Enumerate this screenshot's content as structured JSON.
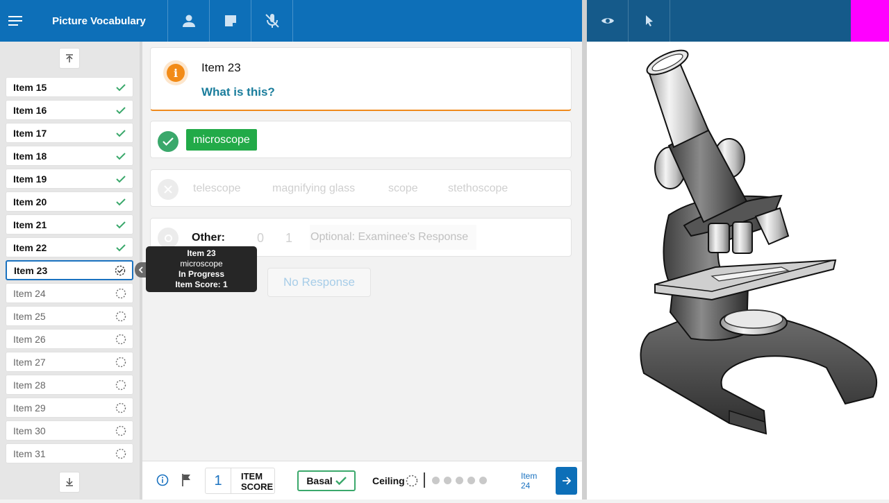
{
  "header": {
    "title": "Picture Vocabulary"
  },
  "sidebar": {
    "items": [
      {
        "label": "Item 15",
        "status": "done"
      },
      {
        "label": "Item 16",
        "status": "done"
      },
      {
        "label": "Item 17",
        "status": "done"
      },
      {
        "label": "Item 18",
        "status": "done"
      },
      {
        "label": "Item 19",
        "status": "done"
      },
      {
        "label": "Item 20",
        "status": "done"
      },
      {
        "label": "Item 21",
        "status": "done"
      },
      {
        "label": "Item 22",
        "status": "done"
      },
      {
        "label": "Item 23",
        "status": "current"
      },
      {
        "label": "Item 24",
        "status": "pending"
      },
      {
        "label": "Item 25",
        "status": "pending"
      },
      {
        "label": "Item 26",
        "status": "pending"
      },
      {
        "label": "Item 27",
        "status": "pending"
      },
      {
        "label": "Item 28",
        "status": "pending"
      },
      {
        "label": "Item 29",
        "status": "pending"
      },
      {
        "label": "Item 30",
        "status": "pending"
      },
      {
        "label": "Item 31",
        "status": "pending"
      }
    ]
  },
  "tooltip": {
    "title": "Item 23",
    "answer": "microscope",
    "status": "In Progress",
    "score": "Item Score: 1"
  },
  "question": {
    "item": "Item 23",
    "prompt": "What is this?"
  },
  "correct_answer": "microscope",
  "incorrect_options": [
    "telescope",
    "magnifying glass",
    "scope",
    "stethoscope"
  ],
  "other": {
    "label": "Other:",
    "score0": "0",
    "score1": "1",
    "placeholder": "Optional: Examinee's Response"
  },
  "no_response": "No Response",
  "footer": {
    "item_score_value": "1",
    "item_score_label_1": "ITEM",
    "item_score_label_2": "SCORE",
    "basal_label": "Basal",
    "ceiling_label": "Ceiling",
    "next_label_1": "Item",
    "next_label_2": "24"
  },
  "colors": {
    "brand": "#0d6fb8",
    "correct": "#22aa48",
    "accent": "#f28b17",
    "link": "#1a7d9c"
  }
}
